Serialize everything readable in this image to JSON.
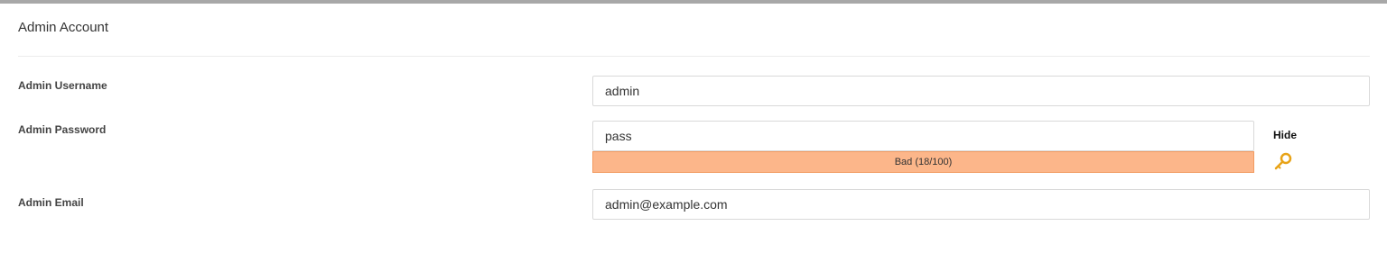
{
  "section": {
    "title": "Admin Account"
  },
  "fields": {
    "username": {
      "label": "Admin Username",
      "value": "admin"
    },
    "password": {
      "label": "Admin Password",
      "value": "pass",
      "strength_text": "Bad (18/100)",
      "strength_score": 18,
      "toggle_label": "Hide",
      "generate_icon": "key-icon"
    },
    "email": {
      "label": "Admin Email",
      "value": "admin@example.com"
    }
  },
  "colors": {
    "strength_bad_fill": "#fcb68a",
    "strength_bad_border": "#f29b61",
    "key_icon": "#e8a317"
  }
}
